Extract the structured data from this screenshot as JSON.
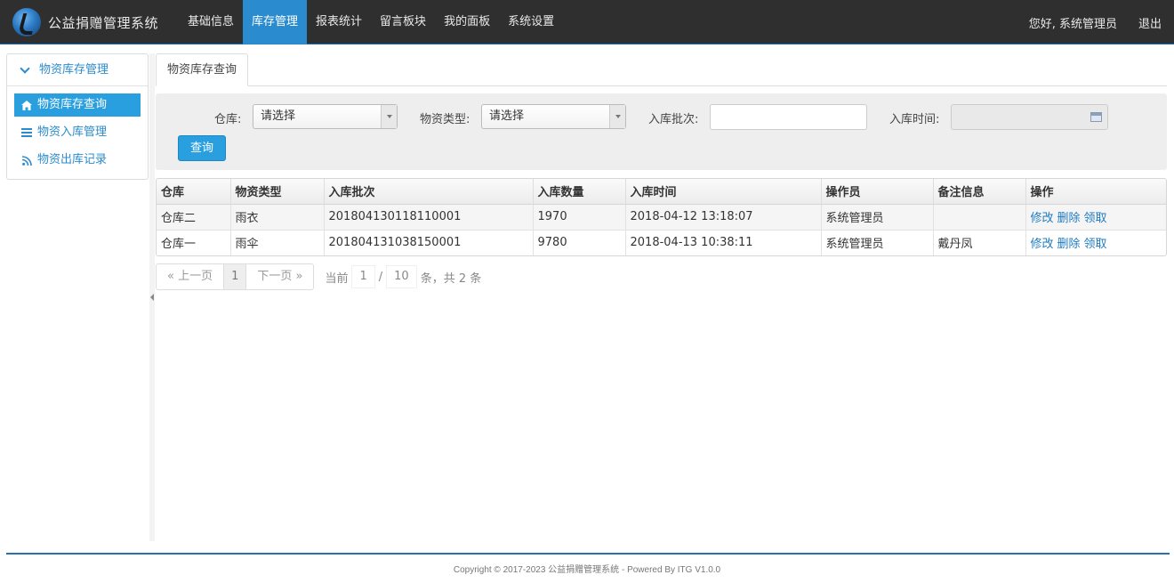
{
  "app": {
    "title": "公益捐赠管理系统"
  },
  "nav": {
    "items": [
      {
        "label": "基础信息",
        "active": false
      },
      {
        "label": "库存管理",
        "active": true
      },
      {
        "label": "报表统计",
        "active": false
      },
      {
        "label": "留言板块",
        "active": false
      },
      {
        "label": "我的面板",
        "active": false
      },
      {
        "label": "系统设置",
        "active": false
      }
    ],
    "greeting": "您好, 系统管理员",
    "logout": "退出"
  },
  "sidebar": {
    "header": "物资库存管理",
    "items": [
      {
        "label": "物资库存查询",
        "icon": "home-icon",
        "active": true
      },
      {
        "label": "物资入库管理",
        "icon": "list-icon",
        "active": false
      },
      {
        "label": "物资出库记录",
        "icon": "rss-icon",
        "active": false
      }
    ]
  },
  "tab": {
    "label": "物资库存查询"
  },
  "filter": {
    "warehouse_label": "仓库:",
    "warehouse_value": "请选择",
    "type_label": "物资类型:",
    "type_value": "请选择",
    "batch_label": "入库批次:",
    "batch_value": "",
    "time_label": "入库时间:",
    "time_value": "",
    "query_button": "查询"
  },
  "table": {
    "columns": [
      "仓库",
      "物资类型",
      "入库批次",
      "入库数量",
      "入库时间",
      "操作员",
      "备注信息",
      "操作"
    ],
    "rows": [
      {
        "warehouse": "仓库二",
        "type": "雨衣",
        "batch": "201804130118110001",
        "qty": "1970",
        "time": "2018-04-12 13:18:07",
        "operator": "系统管理员",
        "note": ""
      },
      {
        "warehouse": "仓库一",
        "type": "雨伞",
        "batch": "201804131038150001",
        "qty": "9780",
        "time": "2018-04-13 10:38:11",
        "operator": "系统管理员",
        "note": "戴丹凤"
      }
    ],
    "actions": {
      "edit": "修改",
      "delete": "删除",
      "claim": "领取"
    }
  },
  "pager": {
    "prev": "« 上一页",
    "page": "1",
    "next": "下一页 »",
    "current_label": "当前",
    "current_page": "1",
    "separator": "/",
    "total_pages": "10",
    "summary": "条，共 2 条"
  },
  "footer": {
    "text": "Copyright © 2017-2023 公益捐赠管理系统 - Powered By ITG V1.0.0"
  },
  "colors": {
    "accent": "#2a9fe0",
    "topbar": "#2f2f2f",
    "link": "#1f7bc1"
  }
}
